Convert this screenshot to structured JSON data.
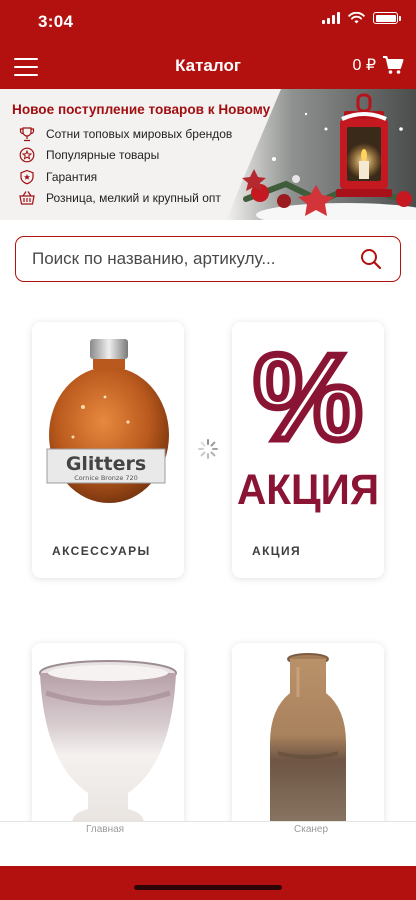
{
  "status_bar": {
    "time": "3:04",
    "icons": [
      "signal-icon",
      "wifi-icon",
      "battery-icon"
    ]
  },
  "header": {
    "title": "Каталог",
    "cart_total": "0 ₽",
    "menu_icon": "hamburger-menu-icon",
    "cart_icon": "shopping-cart-icon"
  },
  "banner": {
    "title": "Новое поступление товаров к Новому году",
    "features": [
      {
        "icon": "trophy-icon",
        "text": "Сотни топовых мировых брендов"
      },
      {
        "icon": "star-badge-icon",
        "text": "Популярные товары"
      },
      {
        "icon": "shield-icon",
        "text": "Гарантия"
      },
      {
        "icon": "basket-icon",
        "text": "Розница, мелкий и крупный опт"
      }
    ]
  },
  "search": {
    "placeholder": "Поиск по названию, артикулу...",
    "value": ""
  },
  "categories": [
    {
      "label": "АКСЕССУАРЫ",
      "image_text": "Glitters",
      "image_subtext": "Cornice Bronze 720"
    },
    {
      "label": "АКЦИЯ",
      "image_text": "%",
      "image_subtext": "АКЦИЯ"
    },
    {
      "label": "",
      "image": "vase-pot"
    },
    {
      "label": "",
      "image": "vase-bottle"
    }
  ],
  "tabbar": {
    "home": "Главная",
    "scanner": "Сканер"
  },
  "colors": {
    "primary": "#b3110f",
    "promo": "#8a1433",
    "banner_title": "#a10f12"
  }
}
